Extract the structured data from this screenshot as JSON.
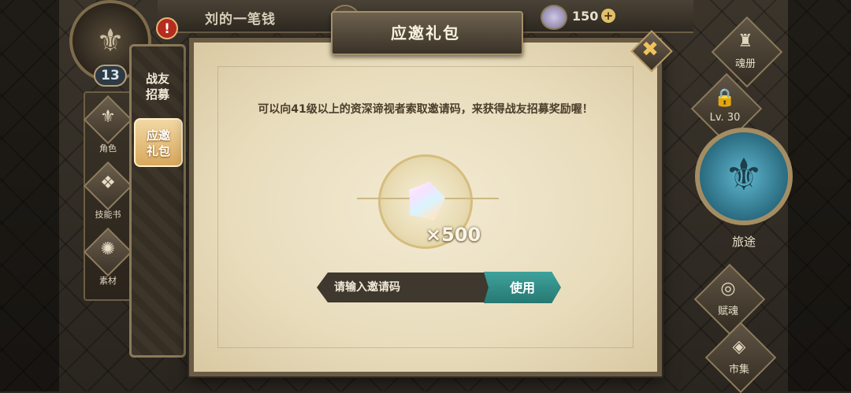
{
  "top_bar": {
    "player_name": "刘的一笔钱",
    "gem_count": "150",
    "plus_icon": "+"
  },
  "profile": {
    "level": "13",
    "alert": "!"
  },
  "left_nav": [
    {
      "label": "角色",
      "icon": "role-icon",
      "glyph": "⚜"
    },
    {
      "label": "技能书",
      "icon": "skill-book-icon",
      "glyph": "❖"
    },
    {
      "label": "素材",
      "icon": "material-icon",
      "glyph": "✺"
    }
  ],
  "tabs": {
    "recruit": "战友\n招募",
    "invite": "应邀\n礼包"
  },
  "right_menu": {
    "soul_book": "魂册",
    "locked_level": "Lv. 30",
    "journey": "旅途",
    "talent": "赋魂",
    "market": "市集"
  },
  "dialog": {
    "title": "应邀礼包",
    "close_glyph": "✖",
    "description": "可以向41级以上的资深谛视者索取邀请码，来获得战友招募奖励喔！",
    "reward_qty": "×500",
    "input_placeholder": "请输入邀请码",
    "use_label": "使用"
  },
  "colors": {
    "accent_teal": "#3fa29c",
    "parchment": "#efe4c8",
    "tab_active": "#e6bf7c"
  }
}
